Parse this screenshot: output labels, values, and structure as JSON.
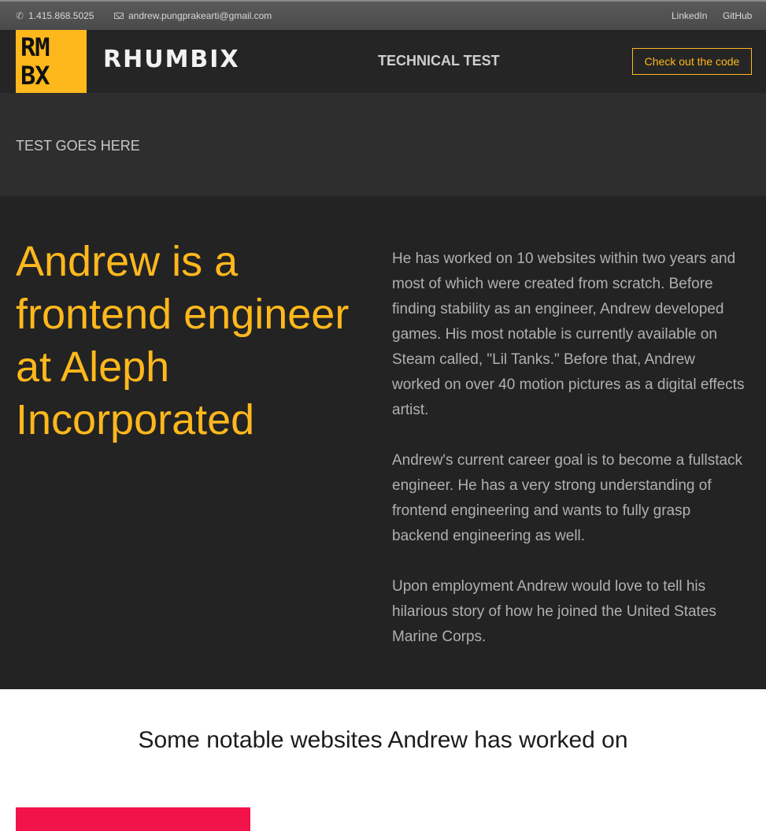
{
  "topbar": {
    "phone_icon": "phone-icon",
    "phone": "1.415.868.5025",
    "email_icon": "mail-icon",
    "email": "andrew.pungprakearti@gmail.com",
    "links": [
      {
        "label": "LinkedIn"
      },
      {
        "label": "GitHub"
      }
    ]
  },
  "header": {
    "logo_row1": "RM",
    "logo_row2": "BX",
    "brand": "RHUMBIX",
    "title": "TECHNICAL TEST",
    "cta_label": "Check out the code"
  },
  "test_section": {
    "text": "TEST GOES HERE"
  },
  "about": {
    "headline": "Andrew is a frontend engineer at Aleph Incorporated",
    "paragraphs": [
      "He has worked on 10 websites within two years and most of which were created from scratch. Before finding stability as an engineer, Andrew developed games. His most notable is currently available on Steam called, \"Lil Tanks.\" Before that, Andrew worked on over 40 motion pictures as a digital effects artist.",
      "Andrew's current career goal is to become a fullstack engineer. He has a very strong understanding of frontend engineering and wants to fully grasp backend engineering as well.",
      "Upon employment Andrew would love to tell his hilarious story of how he joined the United States Marine Corps."
    ]
  },
  "works": {
    "title": "Some notable websites Andrew has worked on"
  },
  "colors": {
    "accent": "#ffb81c",
    "header_bg": "#252525",
    "about_bg": "#232323",
    "card": "#f2134b"
  }
}
